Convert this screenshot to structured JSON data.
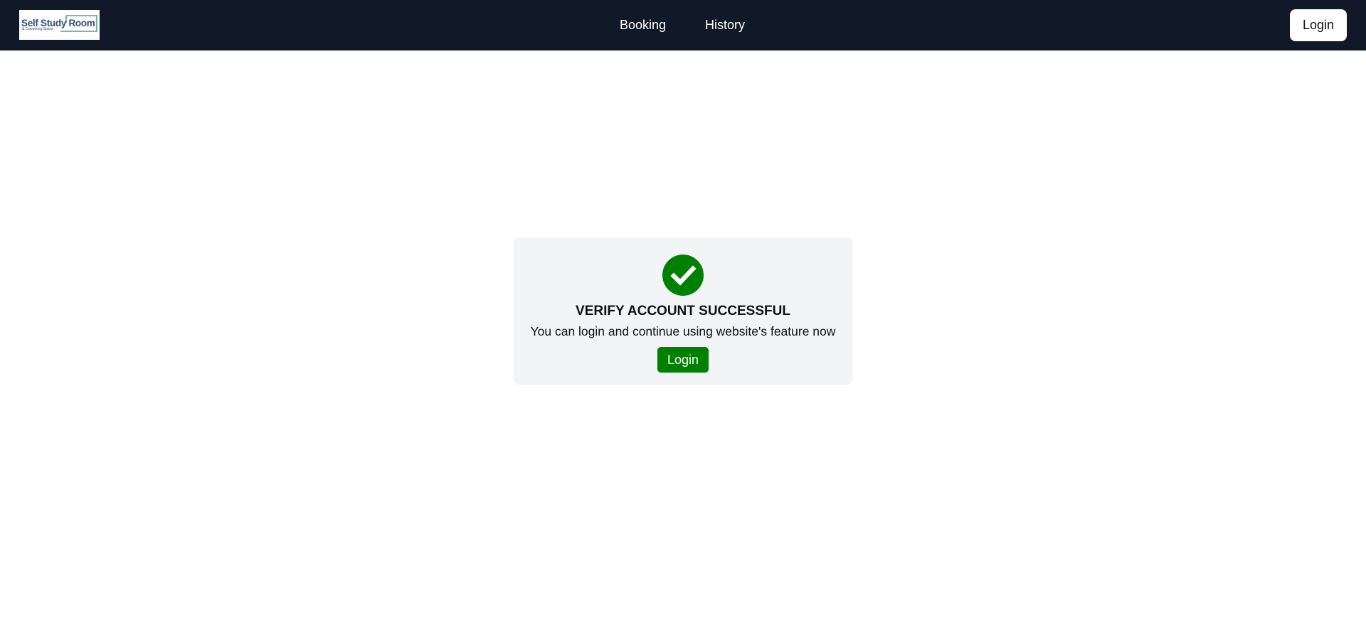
{
  "header": {
    "logo": {
      "main_text": "Self Study Room",
      "sub_text": "& Coworking Space"
    },
    "nav": [
      {
        "label": "Booking"
      },
      {
        "label": "History"
      }
    ],
    "login_label": "Login"
  },
  "verify_card": {
    "icon": "check-circle-icon",
    "title": "VERIFY ACCOUNT SUCCESSFUL",
    "message": "You can login and continue using website's feature now",
    "login_label": "Login"
  },
  "colors": {
    "navbar_bg": "#111827",
    "card_bg": "#f3f4f6",
    "success_green": "#008000",
    "logo_blue": "#334a78",
    "logo_green": "#2e8b6e"
  }
}
